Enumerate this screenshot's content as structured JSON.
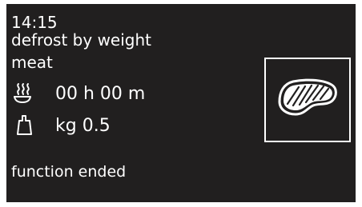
{
  "display": {
    "time": "14:15",
    "program": "defrost by weight",
    "food": "meat",
    "duration": "00 h 00 m",
    "weight": "kg 0.5",
    "status": "function ended"
  },
  "icons": {
    "duration": "defrost-steam-icon",
    "weight": "weight-icon",
    "food": "steak-icon"
  },
  "colors": {
    "screen_background": "#211f1f",
    "text": "#ffffff"
  }
}
